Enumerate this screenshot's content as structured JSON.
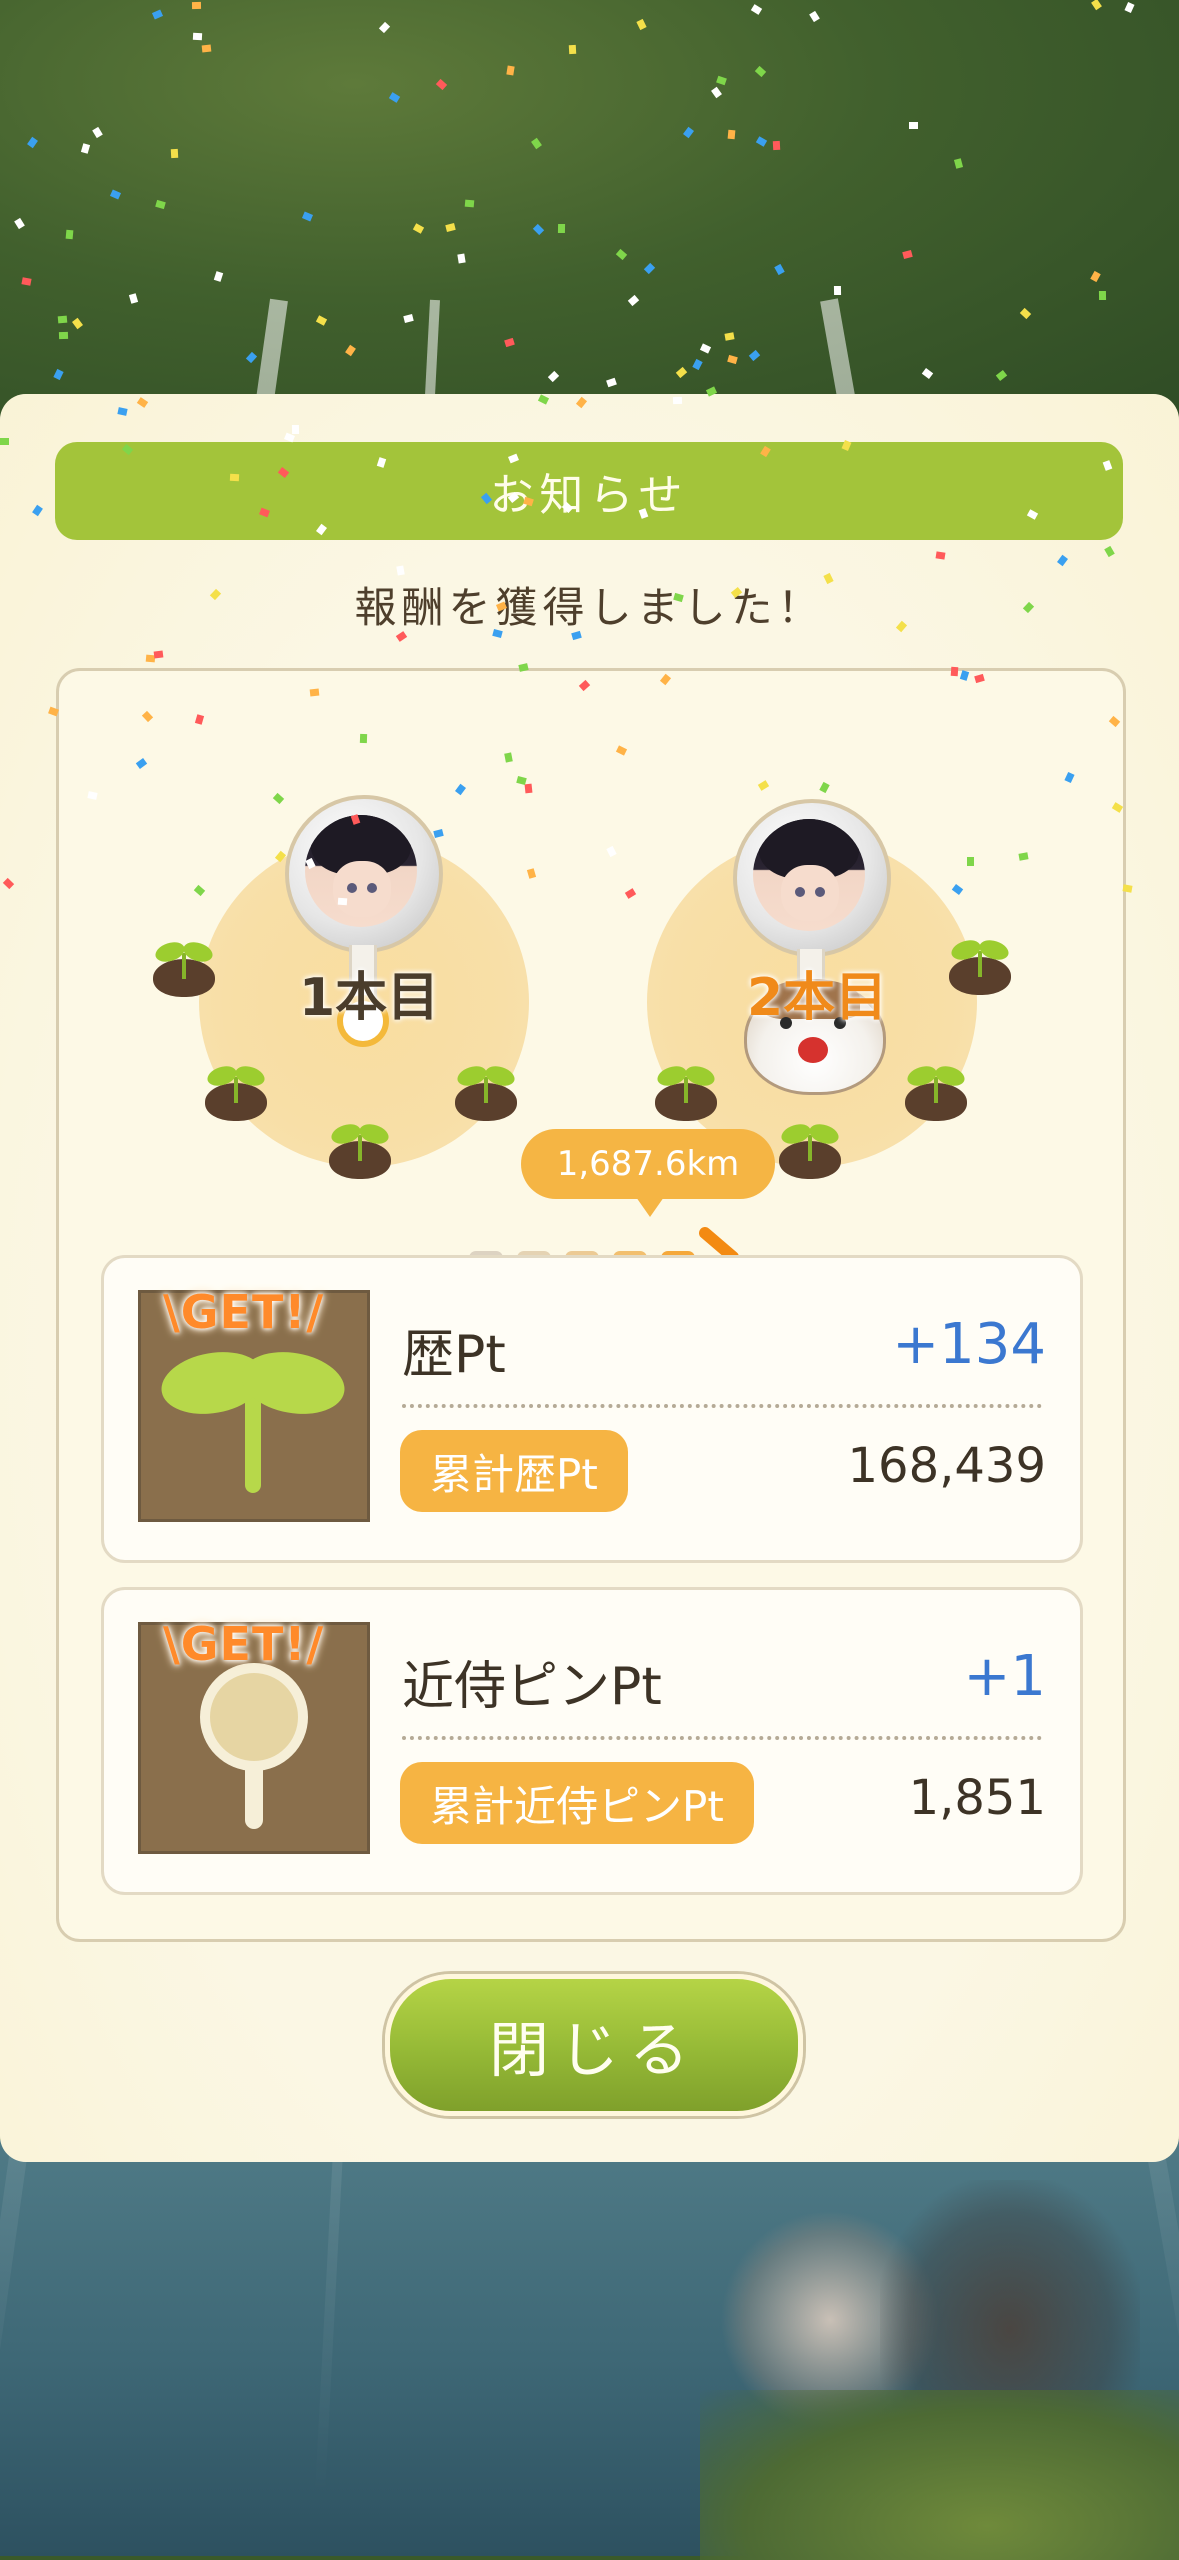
{
  "dialog": {
    "header_title": "お知らせ",
    "subtitle": "報酬を獲得しました！",
    "close_button_label": "閉じる"
  },
  "progress": {
    "from_label": "1本目",
    "to_label": "2本目",
    "distance": "1,687.6km"
  },
  "rewards": [
    {
      "get_label": "\\GET!/",
      "name": "歴Pt",
      "gain": "+134",
      "total_label": "累計歴Pt",
      "total_value": "168,439",
      "icon": "sprout-icon"
    },
    {
      "get_label": "\\GET!/",
      "name": "近侍ピンPt",
      "gain": "+1",
      "total_label": "累計近侍ピンPt",
      "total_value": "1,851",
      "icon": "pin-icon"
    }
  ],
  "colors": {
    "header_green": "#a3c43a",
    "badge_orange": "#f6b443",
    "gain_blue": "#3b78d0",
    "panel_bg": "#fbf7e4"
  }
}
